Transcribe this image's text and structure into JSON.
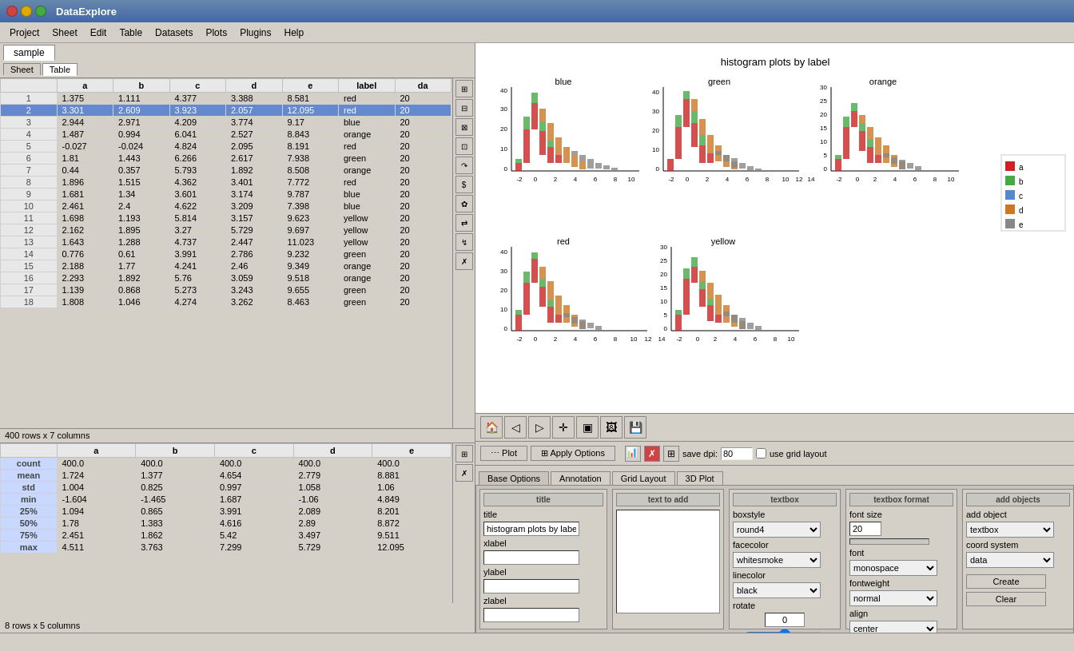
{
  "app": {
    "title": "DataExplore",
    "win_buttons": [
      "close",
      "minimize",
      "maximize"
    ]
  },
  "menu": {
    "items": [
      "Project",
      "Sheet",
      "Edit",
      "Table",
      "Datasets",
      "Plots",
      "Plugins",
      "Help"
    ]
  },
  "tabs": [
    {
      "label": "sample",
      "active": true
    }
  ],
  "subtabs": [
    {
      "label": "Sheet",
      "active": false
    },
    {
      "label": "Table",
      "active": true
    }
  ],
  "data_table": {
    "columns": [
      "",
      "a",
      "b",
      "c",
      "d",
      "e",
      "label",
      "da"
    ],
    "rows": [
      [
        "1",
        "1.375",
        "1.111",
        "4.377",
        "3.388",
        "8.581",
        "red",
        "20"
      ],
      [
        "2",
        "3.301",
        "2.609",
        "3.923",
        "2.057",
        "12.095",
        "red",
        "20"
      ],
      [
        "3",
        "2.944",
        "2.971",
        "4.209",
        "3.774",
        "9.17",
        "blue",
        "20"
      ],
      [
        "4",
        "1.487",
        "0.994",
        "6.041",
        "2.527",
        "8.843",
        "orange",
        "20"
      ],
      [
        "5",
        "-0.027",
        "-0.024",
        "4.824",
        "2.095",
        "8.191",
        "red",
        "20"
      ],
      [
        "6",
        "1.81",
        "1.443",
        "6.266",
        "2.617",
        "7.938",
        "green",
        "20"
      ],
      [
        "7",
        "0.44",
        "0.357",
        "5.793",
        "1.892",
        "8.508",
        "orange",
        "20"
      ],
      [
        "8",
        "1.896",
        "1.515",
        "4.362",
        "3.401",
        "7.772",
        "red",
        "20"
      ],
      [
        "9",
        "1.681",
        "1.34",
        "3.601",
        "3.174",
        "9.787",
        "blue",
        "20"
      ],
      [
        "10",
        "2.461",
        "2.4",
        "4.622",
        "3.209",
        "7.398",
        "blue",
        "20"
      ],
      [
        "11",
        "1.698",
        "1.193",
        "5.814",
        "3.157",
        "9.623",
        "yellow",
        "20"
      ],
      [
        "12",
        "2.162",
        "1.895",
        "3.27",
        "5.729",
        "9.697",
        "yellow",
        "20"
      ],
      [
        "13",
        "1.643",
        "1.288",
        "4.737",
        "2.447",
        "11.023",
        "yellow",
        "20"
      ],
      [
        "14",
        "0.776",
        "0.61",
        "3.991",
        "2.786",
        "9.232",
        "green",
        "20"
      ],
      [
        "15",
        "2.188",
        "1.77",
        "4.241",
        "2.46",
        "9.349",
        "orange",
        "20"
      ],
      [
        "16",
        "2.293",
        "1.892",
        "5.76",
        "3.059",
        "9.518",
        "orange",
        "20"
      ],
      [
        "17",
        "1.139",
        "0.868",
        "5.273",
        "3.243",
        "9.655",
        "green",
        "20"
      ],
      [
        "18",
        "1.808",
        "1.046",
        "4.274",
        "3.262",
        "8.463",
        "green",
        "20"
      ]
    ],
    "status": "400 rows x 7 columns"
  },
  "stats_table": {
    "columns": [
      "",
      "a",
      "b",
      "c",
      "d",
      "e"
    ],
    "rows": [
      [
        "count",
        "400.0",
        "400.0",
        "400.0",
        "400.0",
        "400.0"
      ],
      [
        "mean",
        "1.724",
        "1.377",
        "4.654",
        "2.779",
        "8.881"
      ],
      [
        "std",
        "1.004",
        "0.825",
        "0.997",
        "1.058",
        "1.06"
      ],
      [
        "min",
        "-1.604",
        "-1.465",
        "1.687",
        "-1.06",
        "4.849"
      ],
      [
        "25%",
        "1.094",
        "0.865",
        "3.991",
        "2.089",
        "8.201"
      ],
      [
        "50%",
        "1.78",
        "1.383",
        "4.616",
        "2.89",
        "8.872"
      ],
      [
        "75%",
        "2.451",
        "1.862",
        "5.42",
        "3.497",
        "9.511"
      ],
      [
        "max",
        "4.511",
        "3.763",
        "7.299",
        "5.729",
        "12.095"
      ]
    ],
    "status": "8 rows x 5 columns"
  },
  "plot": {
    "title": "histogram plots by label",
    "subplots": [
      {
        "label": "blue",
        "position": [
          0,
          0
        ]
      },
      {
        "label": "green",
        "position": [
          0,
          1
        ]
      },
      {
        "label": "orange",
        "position": [
          0,
          2
        ]
      },
      {
        "label": "red",
        "position": [
          1,
          0
        ]
      },
      {
        "label": "yellow",
        "position": [
          1,
          1
        ]
      }
    ],
    "legend": [
      {
        "key": "a",
        "color": "#cc2222"
      },
      {
        "key": "b",
        "color": "#44aa44"
      },
      {
        "key": "c",
        "color": "#5588cc"
      },
      {
        "key": "d",
        "color": "#cc7722"
      },
      {
        "key": "e",
        "color": "#888888"
      }
    ]
  },
  "plot_toolbar": {
    "buttons": [
      "home",
      "back",
      "forward",
      "pan",
      "select",
      "image",
      "save"
    ]
  },
  "options": {
    "plot_btn": "Plot",
    "apply_btn": "Apply Options",
    "save_dpi_label": "save dpi:",
    "save_dpi_value": "80",
    "use_grid_label": "use grid layout",
    "tabs": [
      "Base Options",
      "Annotation",
      "Grid Layout",
      "3D Plot"
    ],
    "active_tab": "Base Options",
    "global_labels": {
      "title_label": "title",
      "title_value": "histogram plots by label",
      "xlabel_label": "xlabel",
      "xlabel_value": "",
      "ylabel_label": "ylabel",
      "ylabel_value": "",
      "zlabel_label": "zlabel",
      "zlabel_value": ""
    },
    "text_to_add": {
      "title": "text to add",
      "value": ""
    },
    "textbox": {
      "title": "textbox",
      "boxstyle_label": "boxstyle",
      "boxstyle_value": "round4",
      "facecolor_label": "facecolor",
      "facecolor_value": "whitesmoke",
      "linecolor_label": "linecolor",
      "linecolor_value": "black",
      "rotate_label": "rotate",
      "rotate_value": "0"
    },
    "textbox_format": {
      "title": "textbox format",
      "fontsize_label": "font size",
      "fontsize_value": "20",
      "font_label": "font",
      "font_value": "monospace",
      "fontweight_label": "fontweight",
      "fontweight_value": "normal",
      "align_label": "align",
      "align_value": "center"
    },
    "add_objects": {
      "title": "add objects",
      "add_object_label": "add object",
      "add_object_value": "textbox",
      "coord_system_label": "coord system",
      "coord_system_value": "data",
      "create_btn": "Create",
      "clear_btn": "Clear"
    }
  }
}
